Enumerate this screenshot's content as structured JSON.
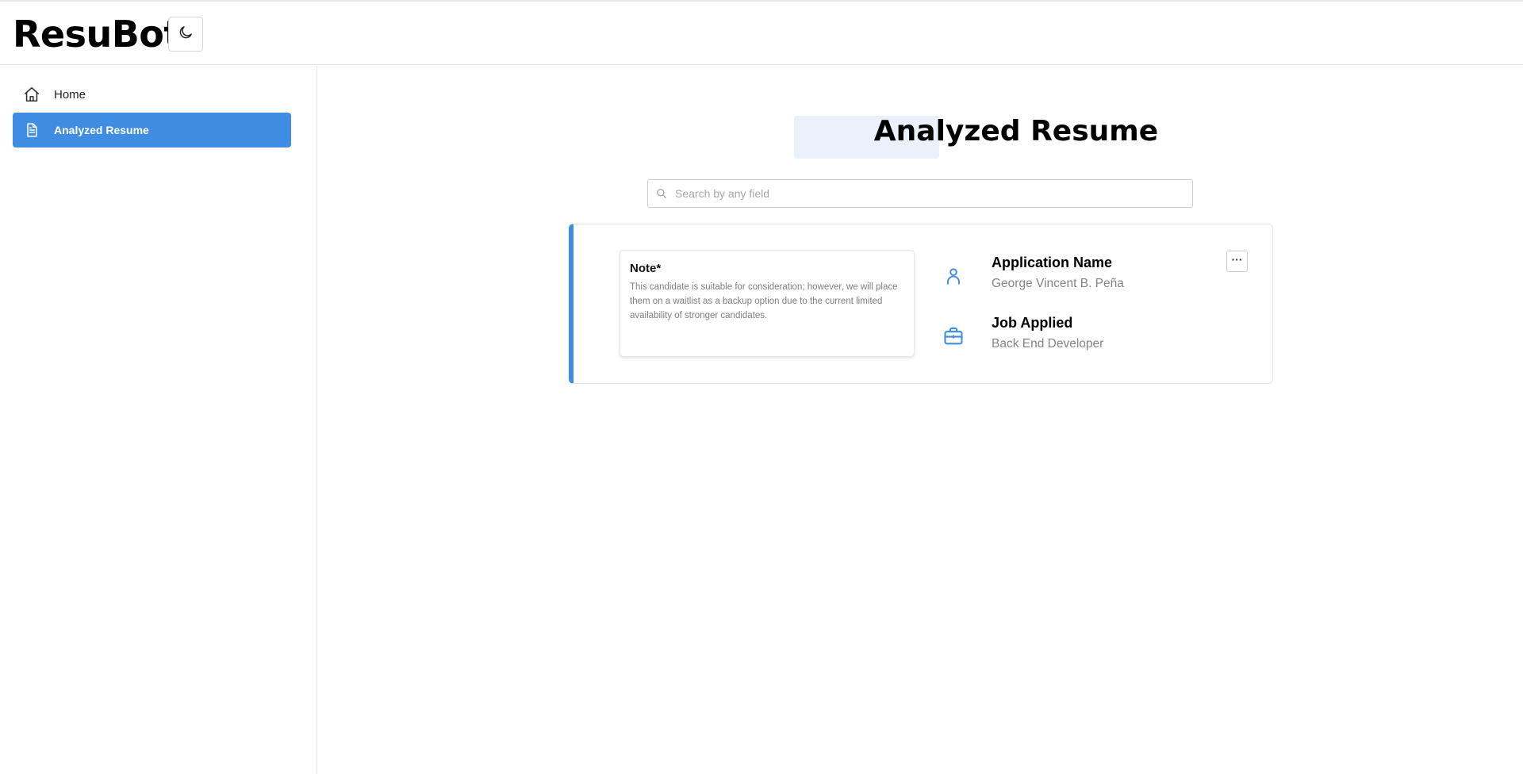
{
  "app": {
    "title": "ResuBot"
  },
  "header": {
    "theme_toggle_icon": "moon-icon"
  },
  "sidebar": {
    "items": [
      {
        "label": "Home",
        "icon": "home-icon",
        "active": false
      },
      {
        "label": "Analyzed Resume",
        "icon": "document-icon",
        "active": true
      }
    ]
  },
  "main": {
    "title_part1": "Analyzed",
    "title_part2": "Resume",
    "search": {
      "placeholder": "Search by any field",
      "value": ""
    },
    "card": {
      "note_title": "Note*",
      "note_text": "This candidate is suitable for consideration; however, we will place them on a waitlist as a backup option due to the current limited availability of stronger candidates.",
      "application_label": "Application Name",
      "application_value": "George Vincent B. Peña",
      "job_label": "Job Applied",
      "job_value": "Back End Developer",
      "more_label": "···"
    }
  },
  "colors": {
    "accent": "#3f8de3",
    "muted_text": "#7f848a",
    "border": "#e3e6ea"
  }
}
